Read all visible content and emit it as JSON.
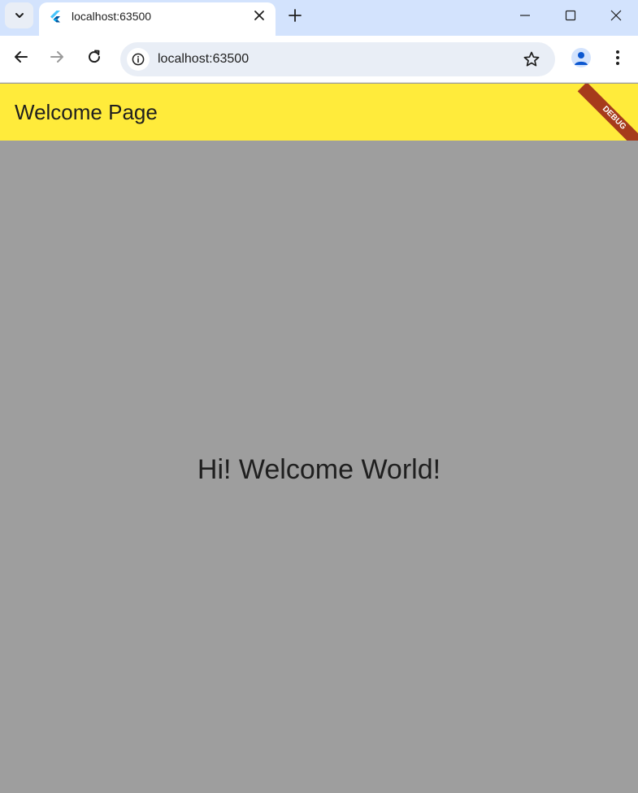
{
  "browser": {
    "tab": {
      "title": "localhost:63500"
    },
    "address_bar": {
      "url": "localhost:63500"
    }
  },
  "app": {
    "appbar_title": "Welcome Page",
    "debug_banner": "DEBUG",
    "body_text": "Hi! Welcome World!",
    "colors": {
      "appbar": "#ffeb3b",
      "body_background": "#9e9e9e",
      "debug_banner": "#a63b1b"
    }
  },
  "icons": [
    "tab-search-icon",
    "flutter-favicon-icon",
    "close-icon",
    "plus-icon",
    "minimize-icon",
    "maximize-icon",
    "window-close-icon",
    "back-arrow-icon",
    "forward-arrow-icon",
    "reload-icon",
    "info-icon",
    "star-icon",
    "profile-icon",
    "more-vertical-icon"
  ]
}
